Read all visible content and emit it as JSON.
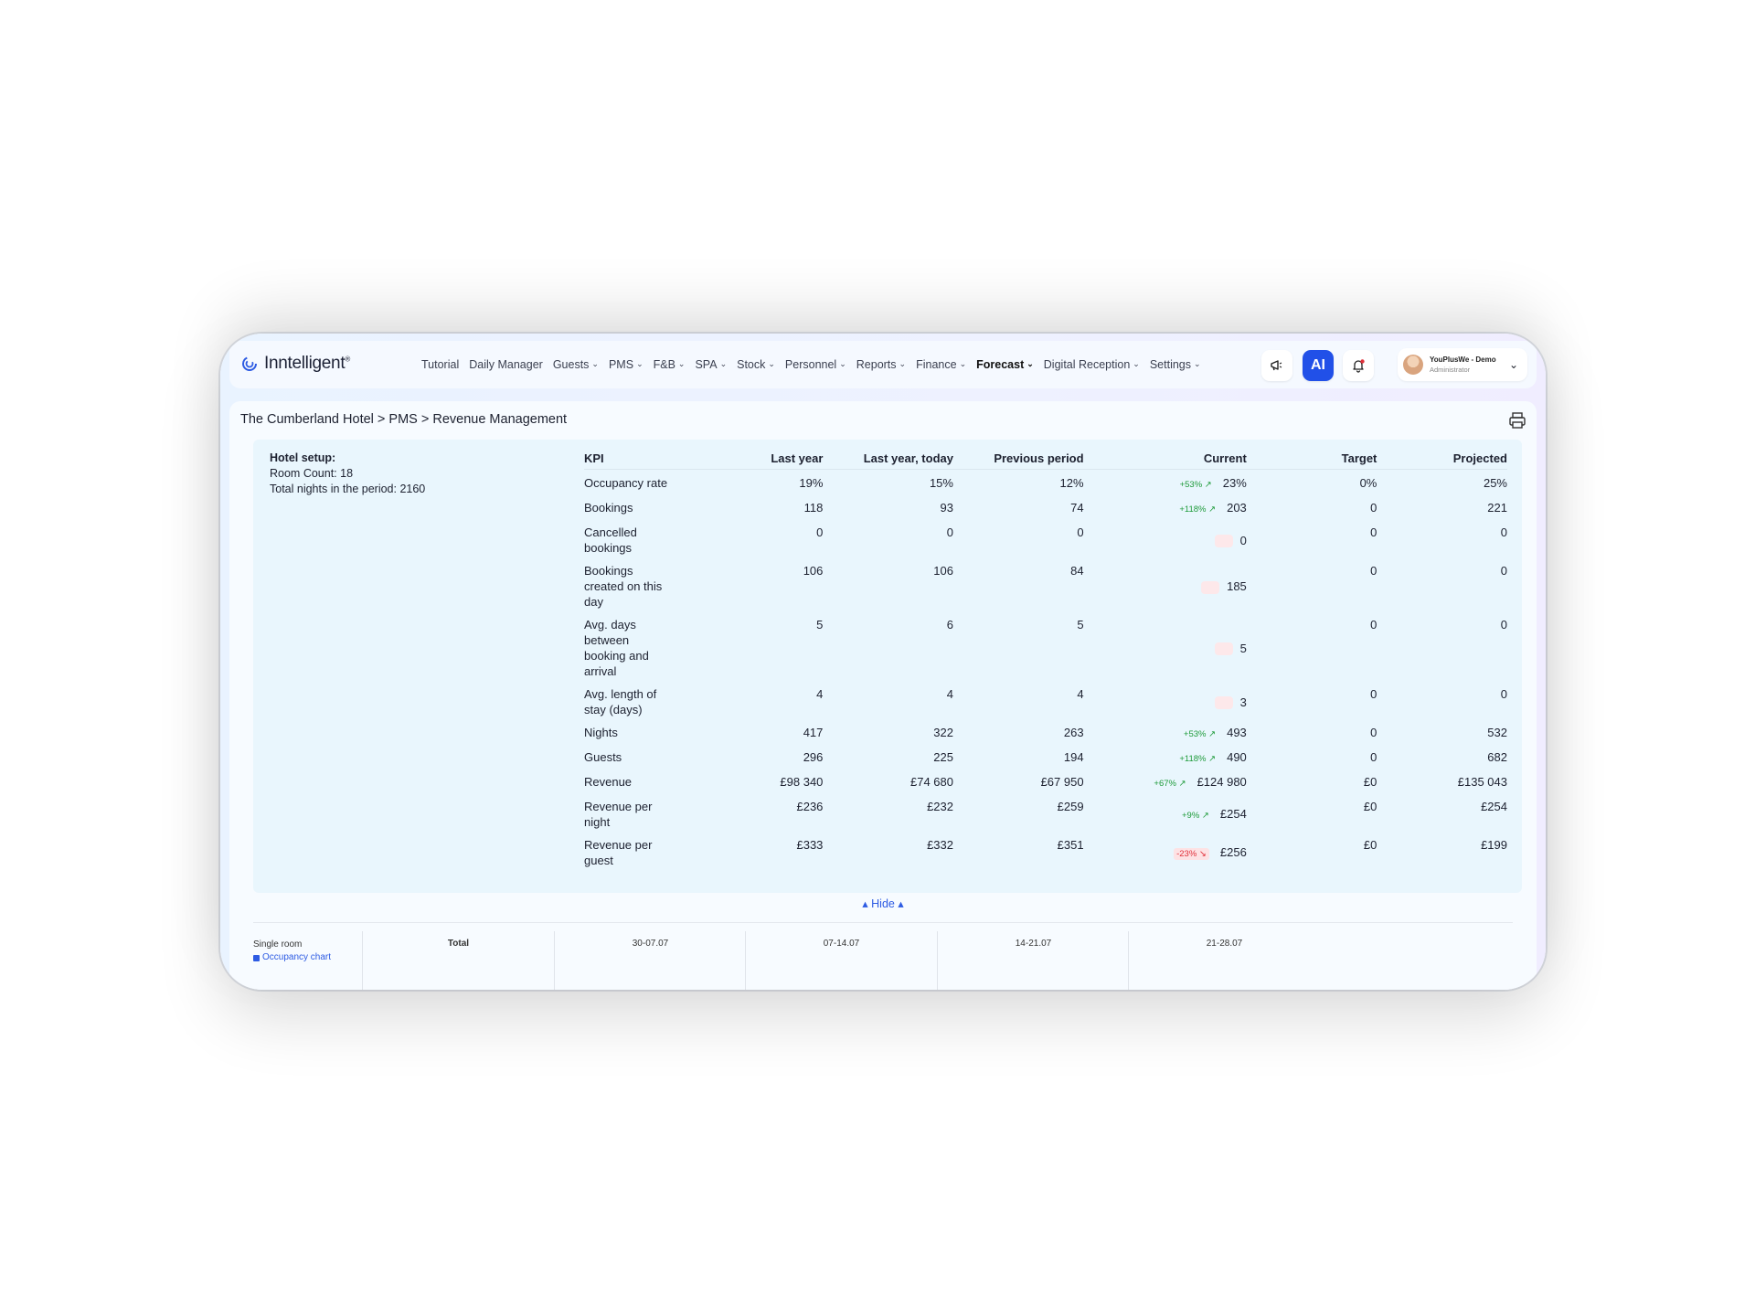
{
  "app": {
    "logo_text": "Inntelligent",
    "logo_sup": "®"
  },
  "nav": [
    {
      "label": "Tutorial",
      "dropdown": false,
      "active": false
    },
    {
      "label": "Daily Manager",
      "dropdown": false,
      "active": false
    },
    {
      "label": "Guests",
      "dropdown": true,
      "active": false
    },
    {
      "label": "PMS",
      "dropdown": true,
      "active": false
    },
    {
      "label": "F&B",
      "dropdown": true,
      "active": false
    },
    {
      "label": "SPA",
      "dropdown": true,
      "active": false
    },
    {
      "label": "Stock",
      "dropdown": true,
      "active": false
    },
    {
      "label": "Personnel",
      "dropdown": true,
      "active": false
    },
    {
      "label": "Reports",
      "dropdown": true,
      "active": false
    },
    {
      "label": "Finance",
      "dropdown": true,
      "active": false
    },
    {
      "label": "Forecast",
      "dropdown": true,
      "active": true
    },
    {
      "label": "Digital Reception",
      "dropdown": true,
      "active": false
    },
    {
      "label": "Settings",
      "dropdown": true,
      "active": false
    }
  ],
  "toolbar": {
    "ai_label": "AI"
  },
  "user": {
    "name": "YouPlusWe - Demo",
    "role": "Administrator"
  },
  "breadcrumb": "The Cumberland Hotel > PMS > Revenue Management",
  "setup": {
    "title": "Hotel setup:",
    "room_count": "Room Count: 18",
    "total_nights": "Total nights in the period: 2160"
  },
  "kpi_table": {
    "headers": [
      "KPI",
      "Last year",
      "Last year, today",
      "Previous period",
      "Current",
      "Target",
      "Projected"
    ],
    "rows": [
      {
        "kpi": "Occupancy rate",
        "last_year": "19%",
        "last_year_today": "15%",
        "previous": "12%",
        "change": "+53% ↗",
        "change_dir": "up",
        "current": "23%",
        "target": "0%",
        "projected": "25%"
      },
      {
        "kpi": "Bookings",
        "last_year": "118",
        "last_year_today": "93",
        "previous": "74",
        "change": "+118% ↗",
        "change_dir": "up",
        "current": "203",
        "target": "0",
        "projected": "221"
      },
      {
        "kpi": "Cancelled bookings",
        "last_year": "0",
        "last_year_today": "0",
        "previous": "0",
        "change": "",
        "change_dir": "none",
        "current": "0",
        "target": "0",
        "projected": "0"
      },
      {
        "kpi": "Bookings created on this day",
        "last_year": "106",
        "last_year_today": "106",
        "previous": "84",
        "change": "",
        "change_dir": "none",
        "current": "185",
        "target": "0",
        "projected": "0"
      },
      {
        "kpi": "Avg. days between booking and arrival",
        "last_year": "5",
        "last_year_today": "6",
        "previous": "5",
        "change": "",
        "change_dir": "none",
        "current": "5",
        "target": "0",
        "projected": "0"
      },
      {
        "kpi": "Avg. length of stay (days)",
        "last_year": "4",
        "last_year_today": "4",
        "previous": "4",
        "change": "",
        "change_dir": "none",
        "current": "3",
        "target": "0",
        "projected": "0"
      },
      {
        "kpi": "Nights",
        "last_year": "417",
        "last_year_today": "322",
        "previous": "263",
        "change": "+53% ↗",
        "change_dir": "up",
        "current": "493",
        "target": "0",
        "projected": "532"
      },
      {
        "kpi": "Guests",
        "last_year": "296",
        "last_year_today": "225",
        "previous": "194",
        "change": "+118% ↗",
        "change_dir": "up",
        "current": "490",
        "target": "0",
        "projected": "682"
      },
      {
        "kpi": "Revenue",
        "last_year": "£98 340",
        "last_year_today": "£74 680",
        "previous": "£67 950",
        "change": "+67% ↗",
        "change_dir": "up",
        "current": "£124 980",
        "target": "£0",
        "projected": "£135 043"
      },
      {
        "kpi": "Revenue per night",
        "last_year": "£236",
        "last_year_today": "£232",
        "previous": "£259",
        "change": "+9% ↗",
        "change_dir": "up",
        "current": "£254",
        "target": "£0",
        "projected": "£254"
      },
      {
        "kpi": "Revenue per guest",
        "last_year": "£333",
        "last_year_today": "£332",
        "previous": "£351",
        "change": "-23% ↘",
        "change_dir": "down",
        "current": "£256",
        "target": "£0",
        "projected": "£199"
      }
    ]
  },
  "hide_label": "▴ Hide ▴",
  "bottom": {
    "room": "Single room",
    "occupancy_link": "Occupancy chart",
    "columns": [
      "Total",
      "30-07.07",
      "07-14.07",
      "14-21.07",
      "21-28.07"
    ]
  },
  "colors": {
    "accent": "#2150e8",
    "up": "#1e9b3a",
    "down": "#e0303a",
    "kpi_bg": "#e9f6fd"
  }
}
